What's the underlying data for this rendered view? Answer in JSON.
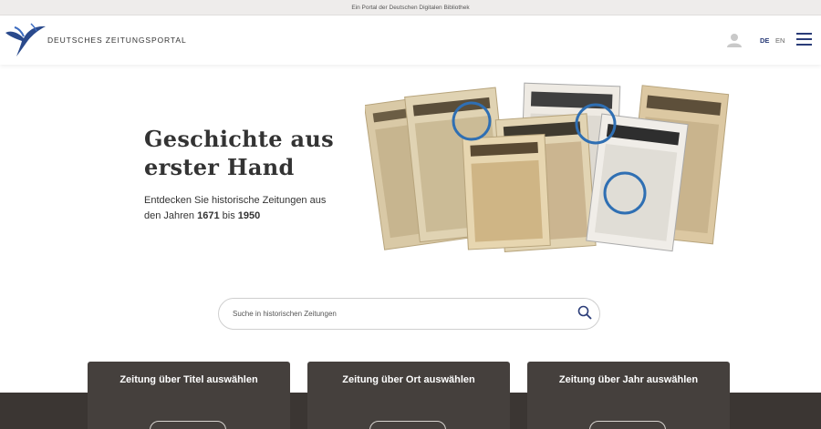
{
  "topbar": {
    "text": "Ein Portal der Deutschen Digitalen Bibliothek"
  },
  "header": {
    "brand": "DEUTSCHES ZEITUNGSPORTAL",
    "lang_de": "DE",
    "lang_en": "EN"
  },
  "hero": {
    "title": "Geschichte aus erster Hand",
    "text_prefix": "Entdecken Sie historische Zeitungen aus den Jahren ",
    "year_from": "1671",
    "text_middle": " bis ",
    "year_to": "1950"
  },
  "search": {
    "placeholder": "Suche in historischen Zeitungen"
  },
  "cards": [
    {
      "title": "Zeitung über Titel auswählen"
    },
    {
      "title": "Zeitung über Ort auswählen"
    },
    {
      "title": "Zeitung über Jahr auswählen"
    }
  ],
  "colors": {
    "accent": "#2a3c78",
    "card_bg": "#45403d",
    "band_bg": "#3b3633"
  }
}
